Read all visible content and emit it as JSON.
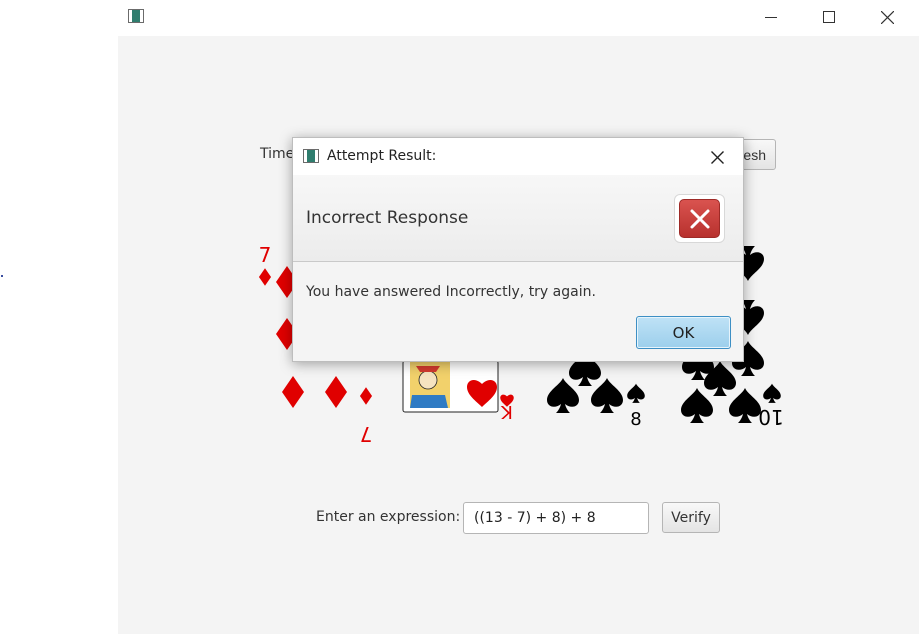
{
  "window": {
    "title": "",
    "controls": {
      "minimize_icon": "minimize-icon",
      "maximize_icon": "maximize-icon",
      "close_icon": "close-icon"
    }
  },
  "main": {
    "timer_label": "Time",
    "refresh_label": "Refresh",
    "cards": [
      {
        "rank": "7",
        "suit": "diamonds",
        "color": "#e00000"
      },
      {
        "rank": "K",
        "suit": "hearts",
        "color": "#e00000"
      },
      {
        "rank": "8",
        "suit": "spades",
        "color": "#000000"
      },
      {
        "rank": "10",
        "suit": "spades",
        "color": "#000000"
      }
    ],
    "expression_label": "Enter an expression:",
    "expression_value": "((13 - 7) + 8) + 8",
    "verify_label": "Verify"
  },
  "dialog": {
    "title": "Attempt Result:",
    "heading": "Incorrect Response",
    "message": "You have answered Incorrectly, try again.",
    "ok_label": "OK",
    "icon": "error-icon",
    "accent_error": "#c9302c",
    "accent_ok": "#9ccfec"
  }
}
